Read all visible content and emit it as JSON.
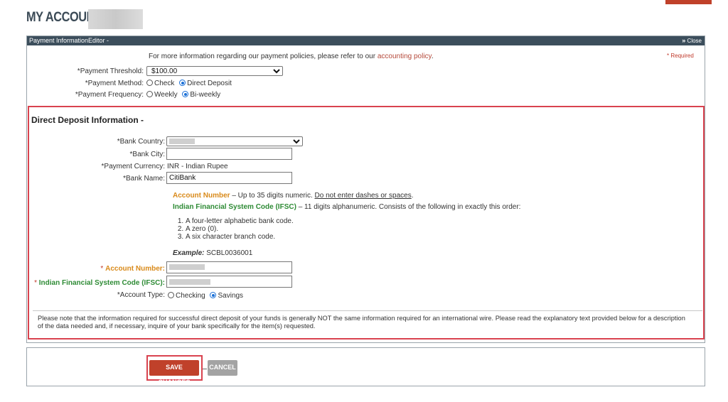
{
  "page": {
    "title": "MY ACCOUNT:"
  },
  "panel": {
    "header": "Payment InformationEditor -",
    "close_arrows": "»",
    "close_label": "Close",
    "info_prefix": "For more information regarding our payment policies, please refer to our ",
    "info_link": "accounting policy",
    "info_suffix": ".",
    "required_note": "* Required",
    "threshold_label": "*Payment Threshold:",
    "threshold_value": "$100.00",
    "method_label": "*Payment Method:",
    "method_options": [
      "Check",
      "Direct Deposit"
    ],
    "method_selected": "Direct Deposit",
    "frequency_label": "*Payment Frequency:",
    "frequency_options": [
      "Weekly",
      "Bi-weekly"
    ],
    "frequency_selected": "Bi-weekly"
  },
  "direct_deposit": {
    "title": "Direct Deposit Information -",
    "bank_country_label": "*Bank Country:",
    "bank_city_label": "*Bank City:",
    "bank_city_value": "",
    "currency_label": "*Payment Currency:",
    "currency_value": "INR - Indian Rupee",
    "bank_name_label": "*Bank Name:",
    "bank_name_value": "CitiBank",
    "acct_help_title": "Account Number",
    "acct_help_text": " – Up to 35 digits numeric. ",
    "acct_help_underline": "Do not enter dashes or spaces",
    "acct_help_end": ".",
    "ifsc_help_title": "Indian Financial System Code (IFSC)",
    "ifsc_help_text": " – 11 digits alphanumeric. Consists of the following in exactly this order:",
    "ifsc_steps": [
      "A four-letter alphabetic bank code.",
      "A zero (0).",
      "A six character branch code."
    ],
    "example_label": "Example:",
    "example_value": "SCBL0036001",
    "account_number_label": "Account Number:",
    "ifsc_label": "Indian Financial System Code (IFSC):",
    "account_type_label": "*Account Type:",
    "account_type_options": [
      "Checking",
      "Savings"
    ],
    "account_type_selected": "Savings",
    "note": "Please note that the information required for successful direct deposit of your funds is generally NOT the same information required for an international wire. Please read the explanatory text provided below for a description of the data needed and, if necessary, inquire of your bank specifically for the item(s) requested."
  },
  "actions": {
    "save_label": "SAVE CHANGES",
    "cancel_label": "CANCEL"
  },
  "colors": {
    "header_bg": "#3c4e5c",
    "highlight": "#d9434f",
    "save_bg": "#c0412a",
    "cancel_bg": "#a3a3a3",
    "account_label": "#d98a1a",
    "ifsc_label": "#2e8b35"
  }
}
